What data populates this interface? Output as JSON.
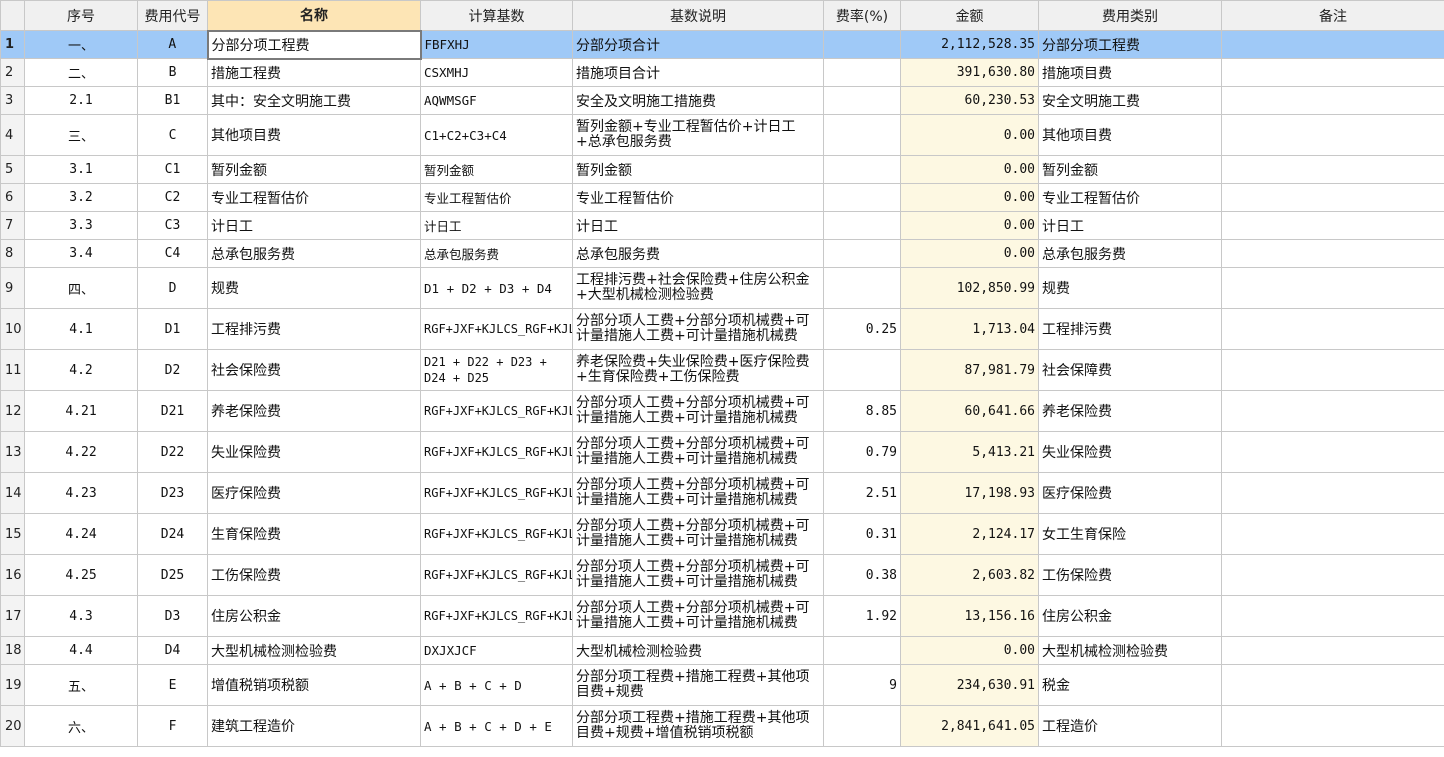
{
  "headers": [
    "",
    "序号",
    "费用代号",
    "名称",
    "计算基数",
    "基数说明",
    "费率(%)",
    "金额",
    "费用类别",
    "备注"
  ],
  "rows": [
    {
      "n": "1",
      "seq": "一、",
      "code": "A",
      "name": "分部分项工程费",
      "base": "FBFXHJ",
      "desc": "分部分项合计",
      "rate": "",
      "amount": "2,112,528.35",
      "category": "分部分项工程费",
      "note": ""
    },
    {
      "n": "2",
      "seq": "二、",
      "code": "B",
      "name": "措施工程费",
      "base": "CSXMHJ",
      "desc": "措施项目合计",
      "rate": "",
      "amount": "391,630.80",
      "category": "措施项目费",
      "note": ""
    },
    {
      "n": "3",
      "seq": "2.1",
      "code": "B1",
      "name": "其中：安全文明施工费",
      "base": "AQWMSGF",
      "desc": "安全及文明施工措施费",
      "rate": "",
      "amount": "60,230.53",
      "category": "安全文明施工费",
      "note": ""
    },
    {
      "n": "4",
      "seq": "三、",
      "code": "C",
      "name": "其他项目费",
      "base": "C1+C2+C3+C4",
      "desc": "暂列金额+专业工程暂估价+计日工+总承包服务费",
      "rate": "",
      "amount": "0.00",
      "category": "其他项目费",
      "note": ""
    },
    {
      "n": "5",
      "seq": "3.1",
      "code": "C1",
      "name": "暂列金额",
      "base": "暂列金额",
      "desc": "暂列金额",
      "rate": "",
      "amount": "0.00",
      "category": "暂列金额",
      "note": ""
    },
    {
      "n": "6",
      "seq": "3.2",
      "code": "C2",
      "name": "专业工程暂估价",
      "base": "专业工程暂估价",
      "desc": "专业工程暂估价",
      "rate": "",
      "amount": "0.00",
      "category": "专业工程暂估价",
      "note": ""
    },
    {
      "n": "7",
      "seq": "3.3",
      "code": "C3",
      "name": "计日工",
      "base": "计日工",
      "desc": "计日工",
      "rate": "",
      "amount": "0.00",
      "category": "计日工",
      "note": ""
    },
    {
      "n": "8",
      "seq": "3.4",
      "code": "C4",
      "name": "总承包服务费",
      "base": "总承包服务费",
      "desc": "总承包服务费",
      "rate": "",
      "amount": "0.00",
      "category": "总承包服务费",
      "note": ""
    },
    {
      "n": "9",
      "seq": "四、",
      "code": "D",
      "name": "规费",
      "base": "D1 + D2 + D3 + D4",
      "desc": "工程排污费+社会保险费+住房公积金+大型机械检测检验费",
      "rate": "",
      "amount": "102,850.99",
      "category": "规费",
      "note": ""
    },
    {
      "n": "10",
      "seq": "4.1",
      "code": "D1",
      "name": "工程排污费",
      "base": "RGF+JXF+KJLCS_RGF+KJLCS_JXF",
      "desc": "分部分项人工费+分部分项机械费+可计量措施人工费+可计量措施机械费",
      "rate": "0.25",
      "amount": "1,713.04",
      "category": "工程排污费",
      "note": ""
    },
    {
      "n": "11",
      "seq": "4.2",
      "code": "D2",
      "name": "社会保险费",
      "base": "D21 + D22 + D23 + D24 + D25",
      "desc": "养老保险费+失业保险费+医疗保险费+生育保险费+工伤保险费",
      "rate": "",
      "amount": "87,981.79",
      "category": "社会保障费",
      "note": ""
    },
    {
      "n": "12",
      "seq": "4.21",
      "code": "D21",
      "name": "养老保险费",
      "base": "RGF+JXF+KJLCS_RGF+KJLCS_JXF",
      "desc": "分部分项人工费+分部分项机械费+可计量措施人工费+可计量措施机械费",
      "rate": "8.85",
      "amount": "60,641.66",
      "category": "养老保险费",
      "note": ""
    },
    {
      "n": "13",
      "seq": "4.22",
      "code": "D22",
      "name": "失业保险费",
      "base": "RGF+JXF+KJLCS_RGF+KJLCS_JXF",
      "desc": "分部分项人工费+分部分项机械费+可计量措施人工费+可计量措施机械费",
      "rate": "0.79",
      "amount": "5,413.21",
      "category": "失业保险费",
      "note": ""
    },
    {
      "n": "14",
      "seq": "4.23",
      "code": "D23",
      "name": "医疗保险费",
      "base": "RGF+JXF+KJLCS_RGF+KJLCS_JXF",
      "desc": "分部分项人工费+分部分项机械费+可计量措施人工费+可计量措施机械费",
      "rate": "2.51",
      "amount": "17,198.93",
      "category": "医疗保险费",
      "note": ""
    },
    {
      "n": "15",
      "seq": "4.24",
      "code": "D24",
      "name": "生育保险费",
      "base": "RGF+JXF+KJLCS_RGF+KJLCS_JXF",
      "desc": "分部分项人工费+分部分项机械费+可计量措施人工费+可计量措施机械费",
      "rate": "0.31",
      "amount": "2,124.17",
      "category": "女工生育保险",
      "note": ""
    },
    {
      "n": "16",
      "seq": "4.25",
      "code": "D25",
      "name": "工伤保险费",
      "base": "RGF+JXF+KJLCS_RGF+KJLCS_JXF",
      "desc": "分部分项人工费+分部分项机械费+可计量措施人工费+可计量措施机械费",
      "rate": "0.38",
      "amount": "2,603.82",
      "category": "工伤保险费",
      "note": ""
    },
    {
      "n": "17",
      "seq": "4.3",
      "code": "D3",
      "name": "住房公积金",
      "base": "RGF+JXF+KJLCS_RGF+KJLCS_JXF",
      "desc": "分部分项人工费+分部分项机械费+可计量措施人工费+可计量措施机械费",
      "rate": "1.92",
      "amount": "13,156.16",
      "category": "住房公积金",
      "note": ""
    },
    {
      "n": "18",
      "seq": "4.4",
      "code": "D4",
      "name": "大型机械检测检验费",
      "base": "DXJXJCF",
      "desc": "大型机械检测检验费",
      "rate": "",
      "amount": "0.00",
      "category": "大型机械检测检验费",
      "note": ""
    },
    {
      "n": "19",
      "seq": "五、",
      "code": "E",
      "name": "增值税销项税额",
      "base": "A + B + C +  D",
      "desc": "分部分项工程费+措施工程费+其他项目费+规费",
      "rate": "9",
      "amount": "234,630.91",
      "category": "税金",
      "note": ""
    },
    {
      "n": "20",
      "seq": "六、",
      "code": "F",
      "name": "建筑工程造价",
      "base": "A + B + C +  D + E",
      "desc": "分部分项工程费+措施工程费+其他项目费+规费+增值税销项税额",
      "rate": "",
      "amount": "2,841,641.05",
      "category": "工程造价",
      "note": ""
    }
  ]
}
